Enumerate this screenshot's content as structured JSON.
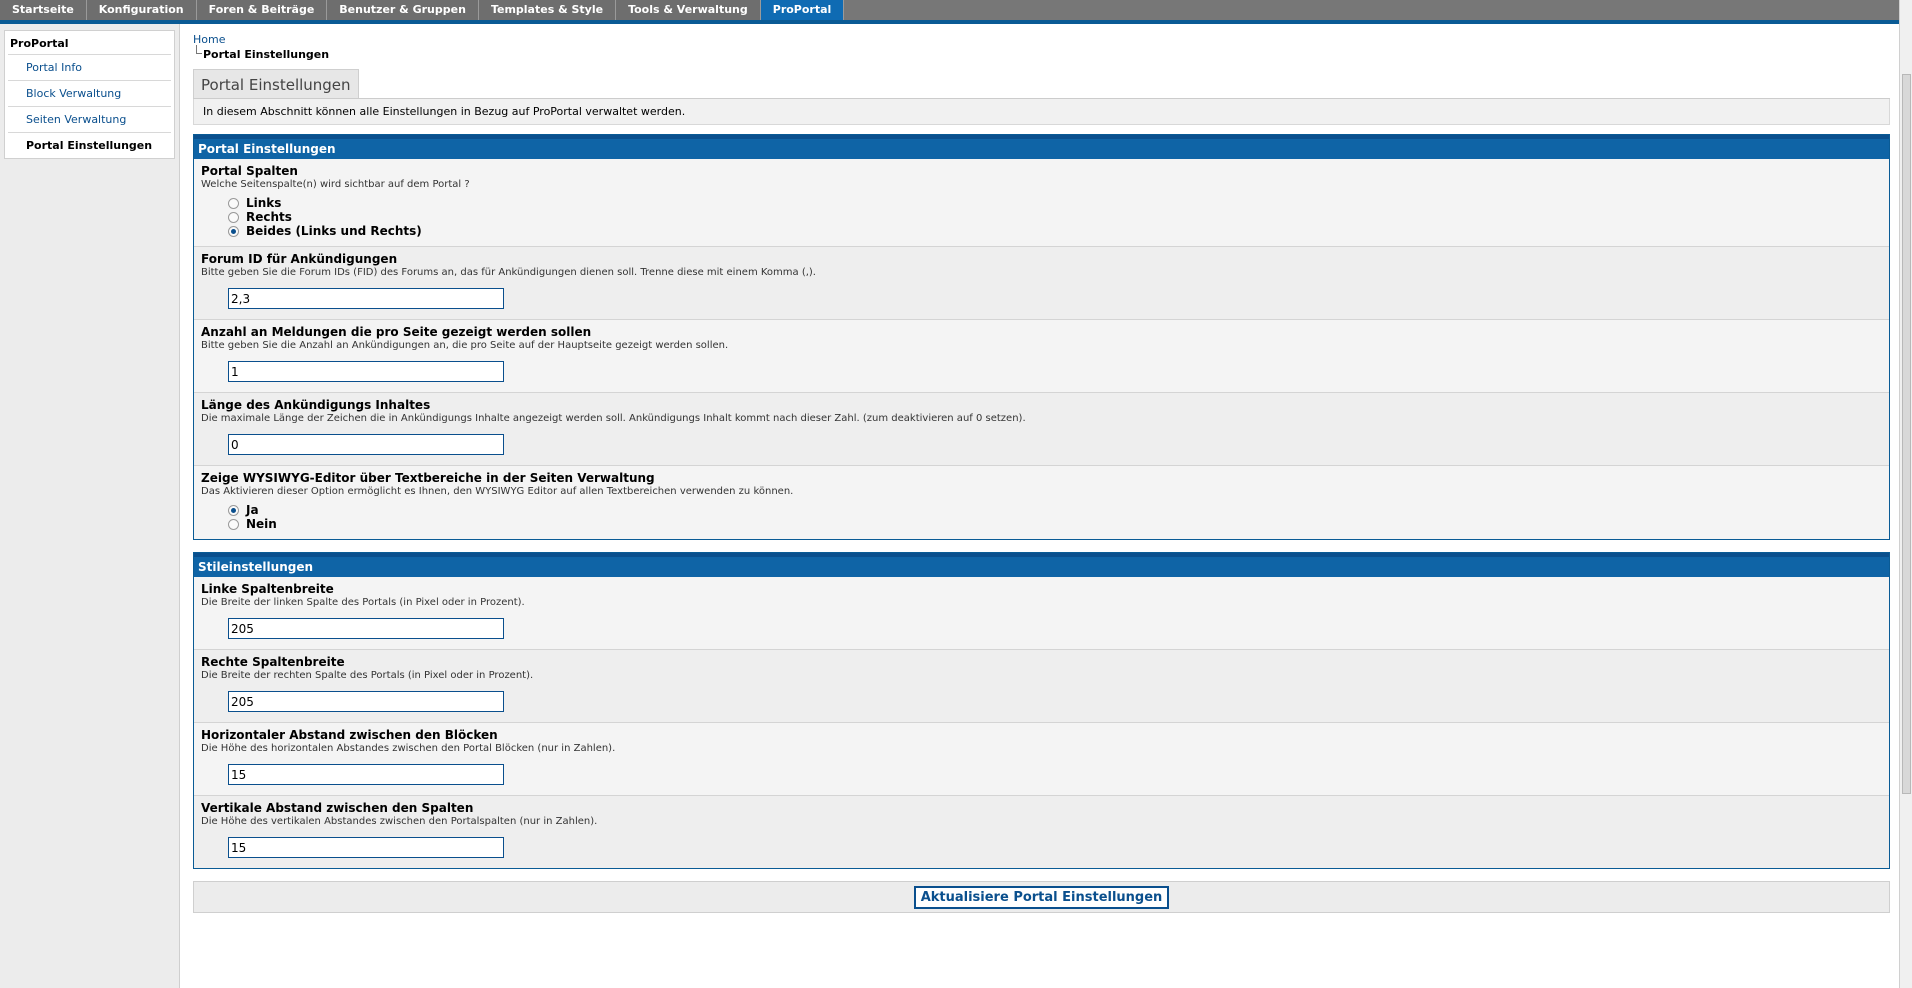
{
  "nav": {
    "tabs": [
      "Startseite",
      "Konfiguration",
      "Foren & Beiträge",
      "Benutzer & Gruppen",
      "Templates & Style",
      "Tools & Verwaltung",
      "ProPortal"
    ],
    "active_index": 6
  },
  "sidebar": {
    "title": "ProPortal",
    "items": [
      "Portal Info",
      "Block Verwaltung",
      "Seiten Verwaltung",
      "Portal Einstellungen"
    ],
    "active_index": 3
  },
  "breadcrumb": {
    "home": "Home",
    "current": "Portal Einstellungen"
  },
  "page_tab": "Portal Einstellungen",
  "description": "In diesem Abschnitt können alle Einstellungen in Bezug auf ProPortal verwaltet werden.",
  "portal_panel": {
    "title": "Portal Einstellungen",
    "spalten": {
      "label": "Portal Spalten",
      "desc": "Welche Seitenspalte(n) wird sichtbar auf dem Portal ?",
      "options": [
        "Links",
        "Rechts",
        "Beides (Links und Rechts)"
      ],
      "selected": "Beides (Links und Rechts)"
    },
    "forum_id": {
      "label": "Forum ID für Ankündigungen",
      "desc": "Bitte geben Sie die Forum IDs (FID) des Forums an, das für Ankündigungen dienen soll. Trenne diese mit einem Komma (,).",
      "value": "2,3"
    },
    "anzahl": {
      "label": "Anzahl an Meldungen die pro Seite gezeigt werden sollen",
      "desc": "Bitte geben Sie die Anzahl an Ankündigungen an, die pro Seite auf der Hauptseite gezeigt werden sollen.",
      "value": "1"
    },
    "laenge": {
      "label": "Länge des Ankündigungs Inhaltes",
      "desc": "Die maximale Länge der Zeichen die in Ankündigungs Inhalte angezeigt werden soll. Ankündigungs Inhalt kommt nach dieser Zahl. (zum deaktivieren auf 0 setzen).",
      "value": "0"
    },
    "wysiwyg": {
      "label": "Zeige WYSIWYG-Editor über Textbereiche in der Seiten Verwaltung",
      "desc": "Das Aktivieren dieser Option ermöglicht es Ihnen, den WYSIWYG Editor auf allen Textbereichen verwenden zu können.",
      "options": [
        "Ja",
        "Nein"
      ],
      "selected": "Ja"
    }
  },
  "style_panel": {
    "title": "Stileinstellungen",
    "links": {
      "label": "Linke Spaltenbreite",
      "desc": "Die Breite der linken Spalte des Portals (in Pixel oder in Prozent).",
      "value": "205"
    },
    "rechts": {
      "label": "Rechte Spaltenbreite",
      "desc": "Die Breite der rechten Spalte des Portals (in Pixel oder in Prozent).",
      "value": "205"
    },
    "horizontal": {
      "label": "Horizontaler Abstand zwischen den Blöcken",
      "desc": "Die Höhe des horizontalen Abstandes zwischen den Portal Blöcken (nur in Zahlen).",
      "value": "15"
    },
    "vertikal": {
      "label": "Vertikale Abstand zwischen den Spalten",
      "desc": "Die Höhe des vertikalen Abstandes zwischen den Portalspalten (nur in Zahlen).",
      "value": "15"
    }
  },
  "save_button": "Aktualisiere Portal Einstellungen"
}
